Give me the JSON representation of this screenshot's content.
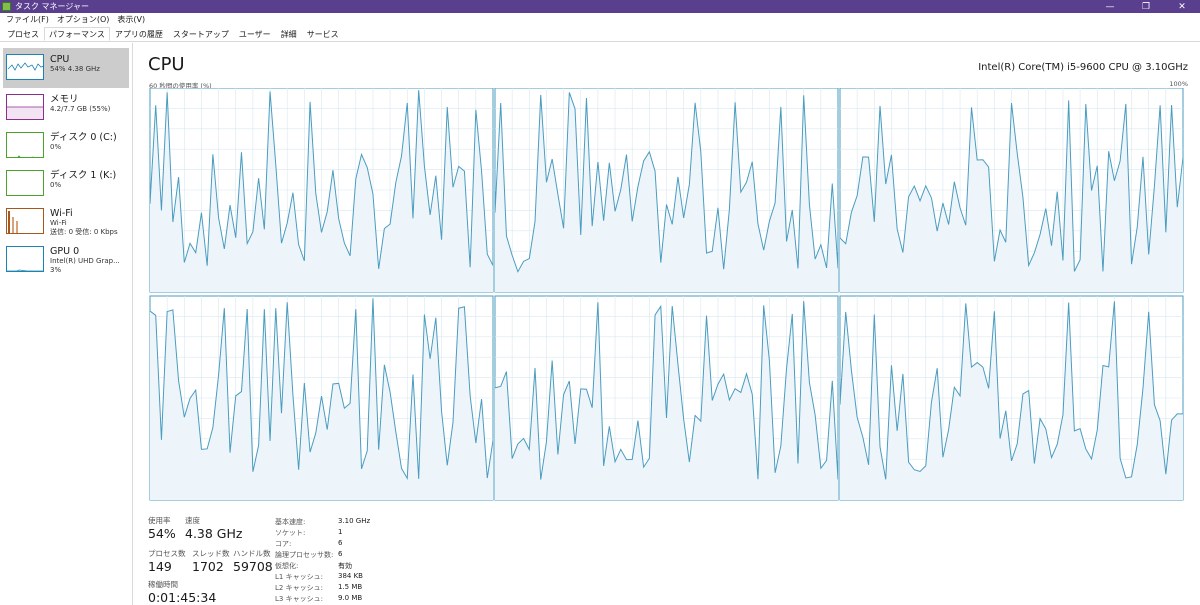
{
  "window": {
    "title": "タスク マネージャー",
    "minimize_glyph": "—",
    "restore_glyph": "❐",
    "close_glyph": "✕"
  },
  "menu": [
    "ファイル(F)",
    "オプション(O)",
    "表示(V)"
  ],
  "tabs": [
    "プロセス",
    "パフォーマンス",
    "アプリの履歴",
    "スタートアップ",
    "ユーザー",
    "詳細",
    "サービス"
  ],
  "active_tab": "パフォーマンス",
  "sidebar": {
    "items": [
      {
        "name": "CPU",
        "line1": "54%  4.38 GHz",
        "line2": "",
        "color": "#1b84b2"
      },
      {
        "name": "メモリ",
        "line1": "4.2/7.7 GB (55%)",
        "line2": "",
        "color": "#8b2f8b"
      },
      {
        "name": "ディスク 0 (C:)",
        "line1": "0%",
        "line2": "",
        "color": "#4ca02c"
      },
      {
        "name": "ディスク 1 (K:)",
        "line1": "0%",
        "line2": "",
        "color": "#4ca02c"
      },
      {
        "name": "Wi-Fi",
        "line1": "Wi-Fi",
        "line2": "送信: 0 受信: 0 Kbps",
        "color": "#a7561c"
      },
      {
        "name": "GPU 0",
        "line1": "Intel(R) UHD Grap...",
        "line2": "3%",
        "color": "#1b84b2"
      }
    ]
  },
  "main": {
    "title": "CPU",
    "model": "Intel(R) Core(TM) i5-9600 CPU @ 3.10GHz",
    "graph_label": "60 秒間の使用率 (%)",
    "graph_max": "100%",
    "graph_color": "#4a9cc0",
    "graph_fill": "#eef5fa",
    "grid_color": "#d8e8f0"
  },
  "stats": {
    "usage_label": "使用率",
    "usage_value": "54%",
    "speed_label": "速度",
    "speed_value": "4.38 GHz",
    "processes_label": "プロセス数",
    "processes_value": "149",
    "threads_label": "スレッド数",
    "threads_value": "1702",
    "handles_label": "ハンドル数",
    "handles_value": "59708",
    "uptime_label": "稼働時間",
    "uptime_value": "0:01:45:34"
  },
  "specs": [
    {
      "key": "基本速度:",
      "value": "3.10 GHz"
    },
    {
      "key": "ソケット:",
      "value": "1"
    },
    {
      "key": "コア:",
      "value": "6"
    },
    {
      "key": "論理プロセッサ数:",
      "value": "6"
    },
    {
      "key": "仮想化:",
      "value": "有効"
    },
    {
      "key": "L1 キャッシュ:",
      "value": "384 KB"
    },
    {
      "key": "L2 キャッシュ:",
      "value": "1.5 MB"
    },
    {
      "key": "L3 キャッシュ:",
      "value": "9.0 MB"
    }
  ]
}
